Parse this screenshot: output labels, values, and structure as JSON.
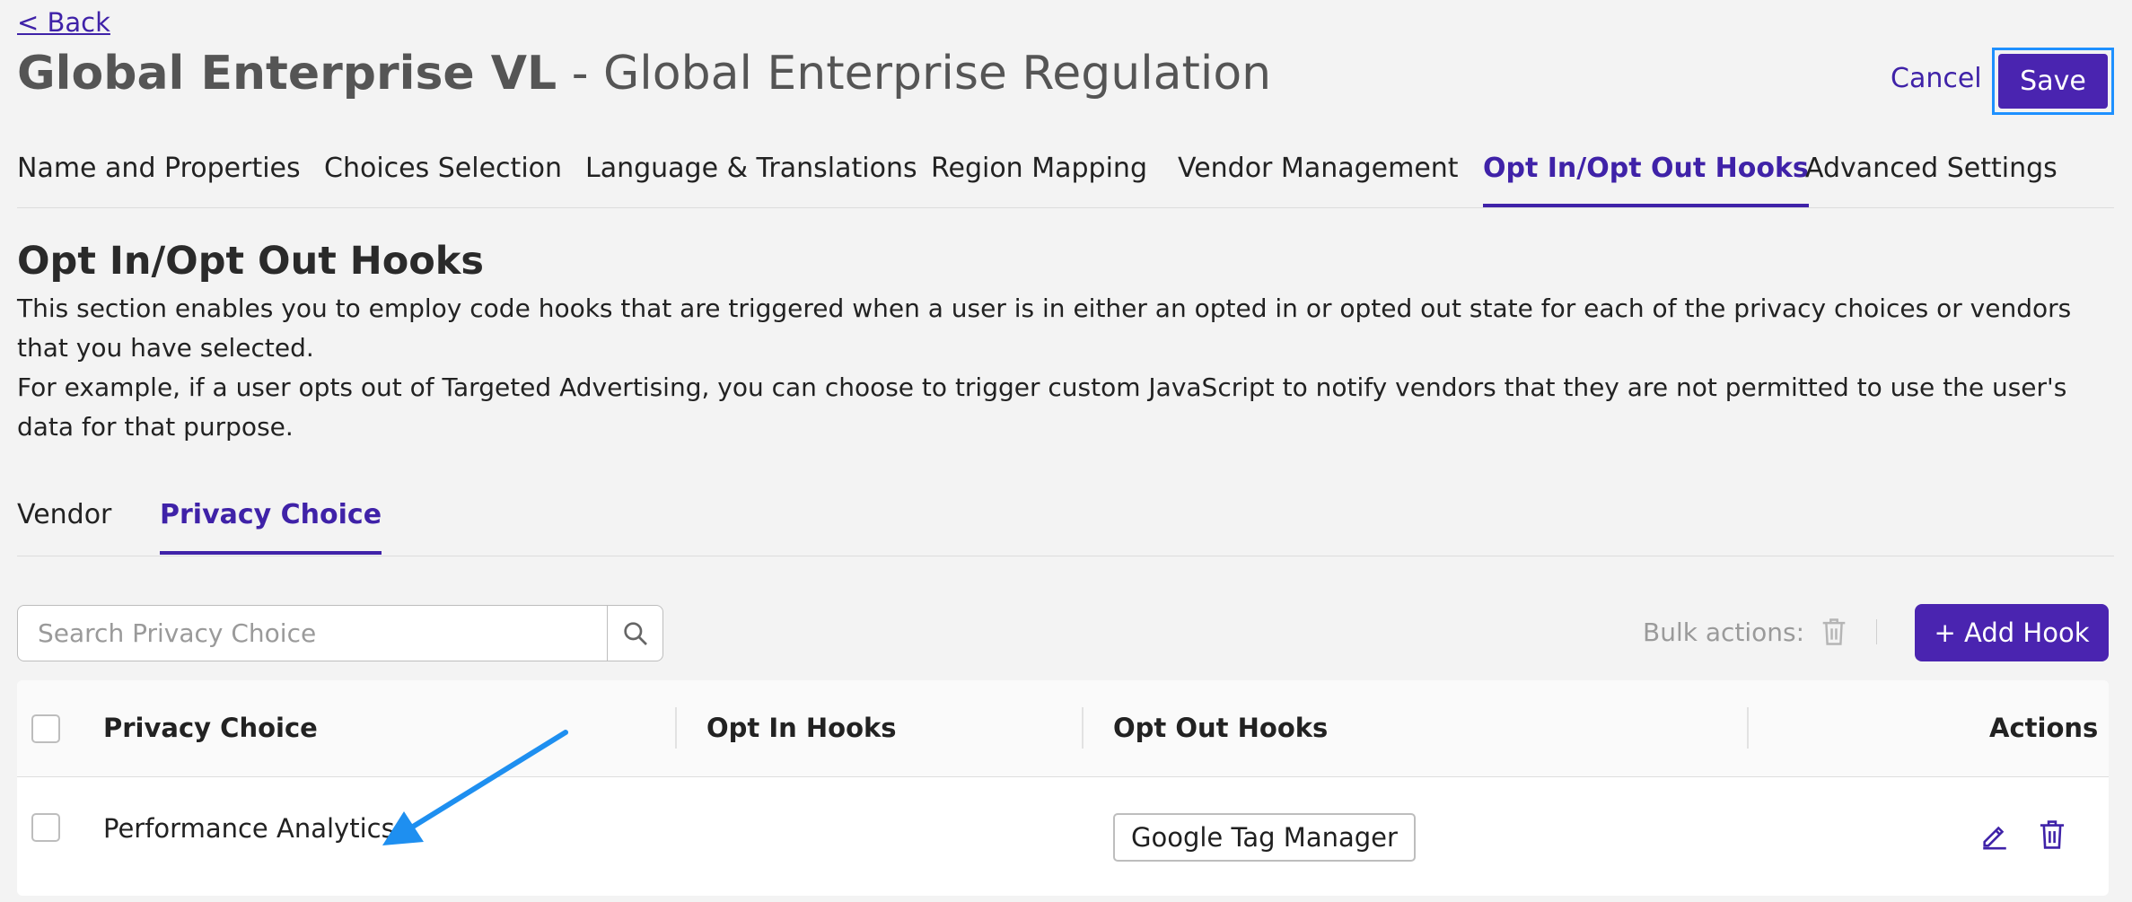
{
  "header": {
    "back_label": "< Back",
    "title_bold": "Global Enterprise VL",
    "title_rest": " - Global Enterprise Regulation",
    "cancel_label": "Cancel",
    "save_label": "Save"
  },
  "tabs": [
    {
      "label": "Name and Properties",
      "active": false
    },
    {
      "label": "Choices Selection",
      "active": false
    },
    {
      "label": "Language & Translations",
      "active": false
    },
    {
      "label": "Region Mapping",
      "active": false
    },
    {
      "label": "Vendor Management",
      "active": false
    },
    {
      "label": "Opt In/Opt Out Hooks",
      "active": true
    },
    {
      "label": "Advanced Settings",
      "active": false
    }
  ],
  "section": {
    "title": "Opt In/Opt Out Hooks",
    "description_1": "This section enables you to employ code hooks that are triggered when a user is in either an opted in or opted out state for each of the privacy choices or vendors that you have selected.",
    "description_2": "For example, if a user opts out of Targeted Advertising, you can choose to trigger custom JavaScript to notify vendors that they are not permitted to use the user's data for that purpose."
  },
  "subtabs": [
    {
      "label": "Vendor",
      "active": false
    },
    {
      "label": "Privacy Choice",
      "active": true
    }
  ],
  "search": {
    "placeholder": "Search Privacy Choice",
    "value": ""
  },
  "bulk_actions_label": "Bulk actions:",
  "add_hook_label": "+ Add Hook",
  "table": {
    "columns": [
      "Privacy Choice",
      "Opt In Hooks",
      "Opt Out Hooks",
      "Actions"
    ],
    "rows": [
      {
        "privacy_choice": "Performance Analytics",
        "opt_in_hooks": "",
        "opt_out_hooks": "Google Tag Manager"
      }
    ]
  },
  "colors": {
    "accent": "#4a24b0",
    "focus_ring": "#1e90ff",
    "annotation_arrow": "#1e8ff0"
  }
}
